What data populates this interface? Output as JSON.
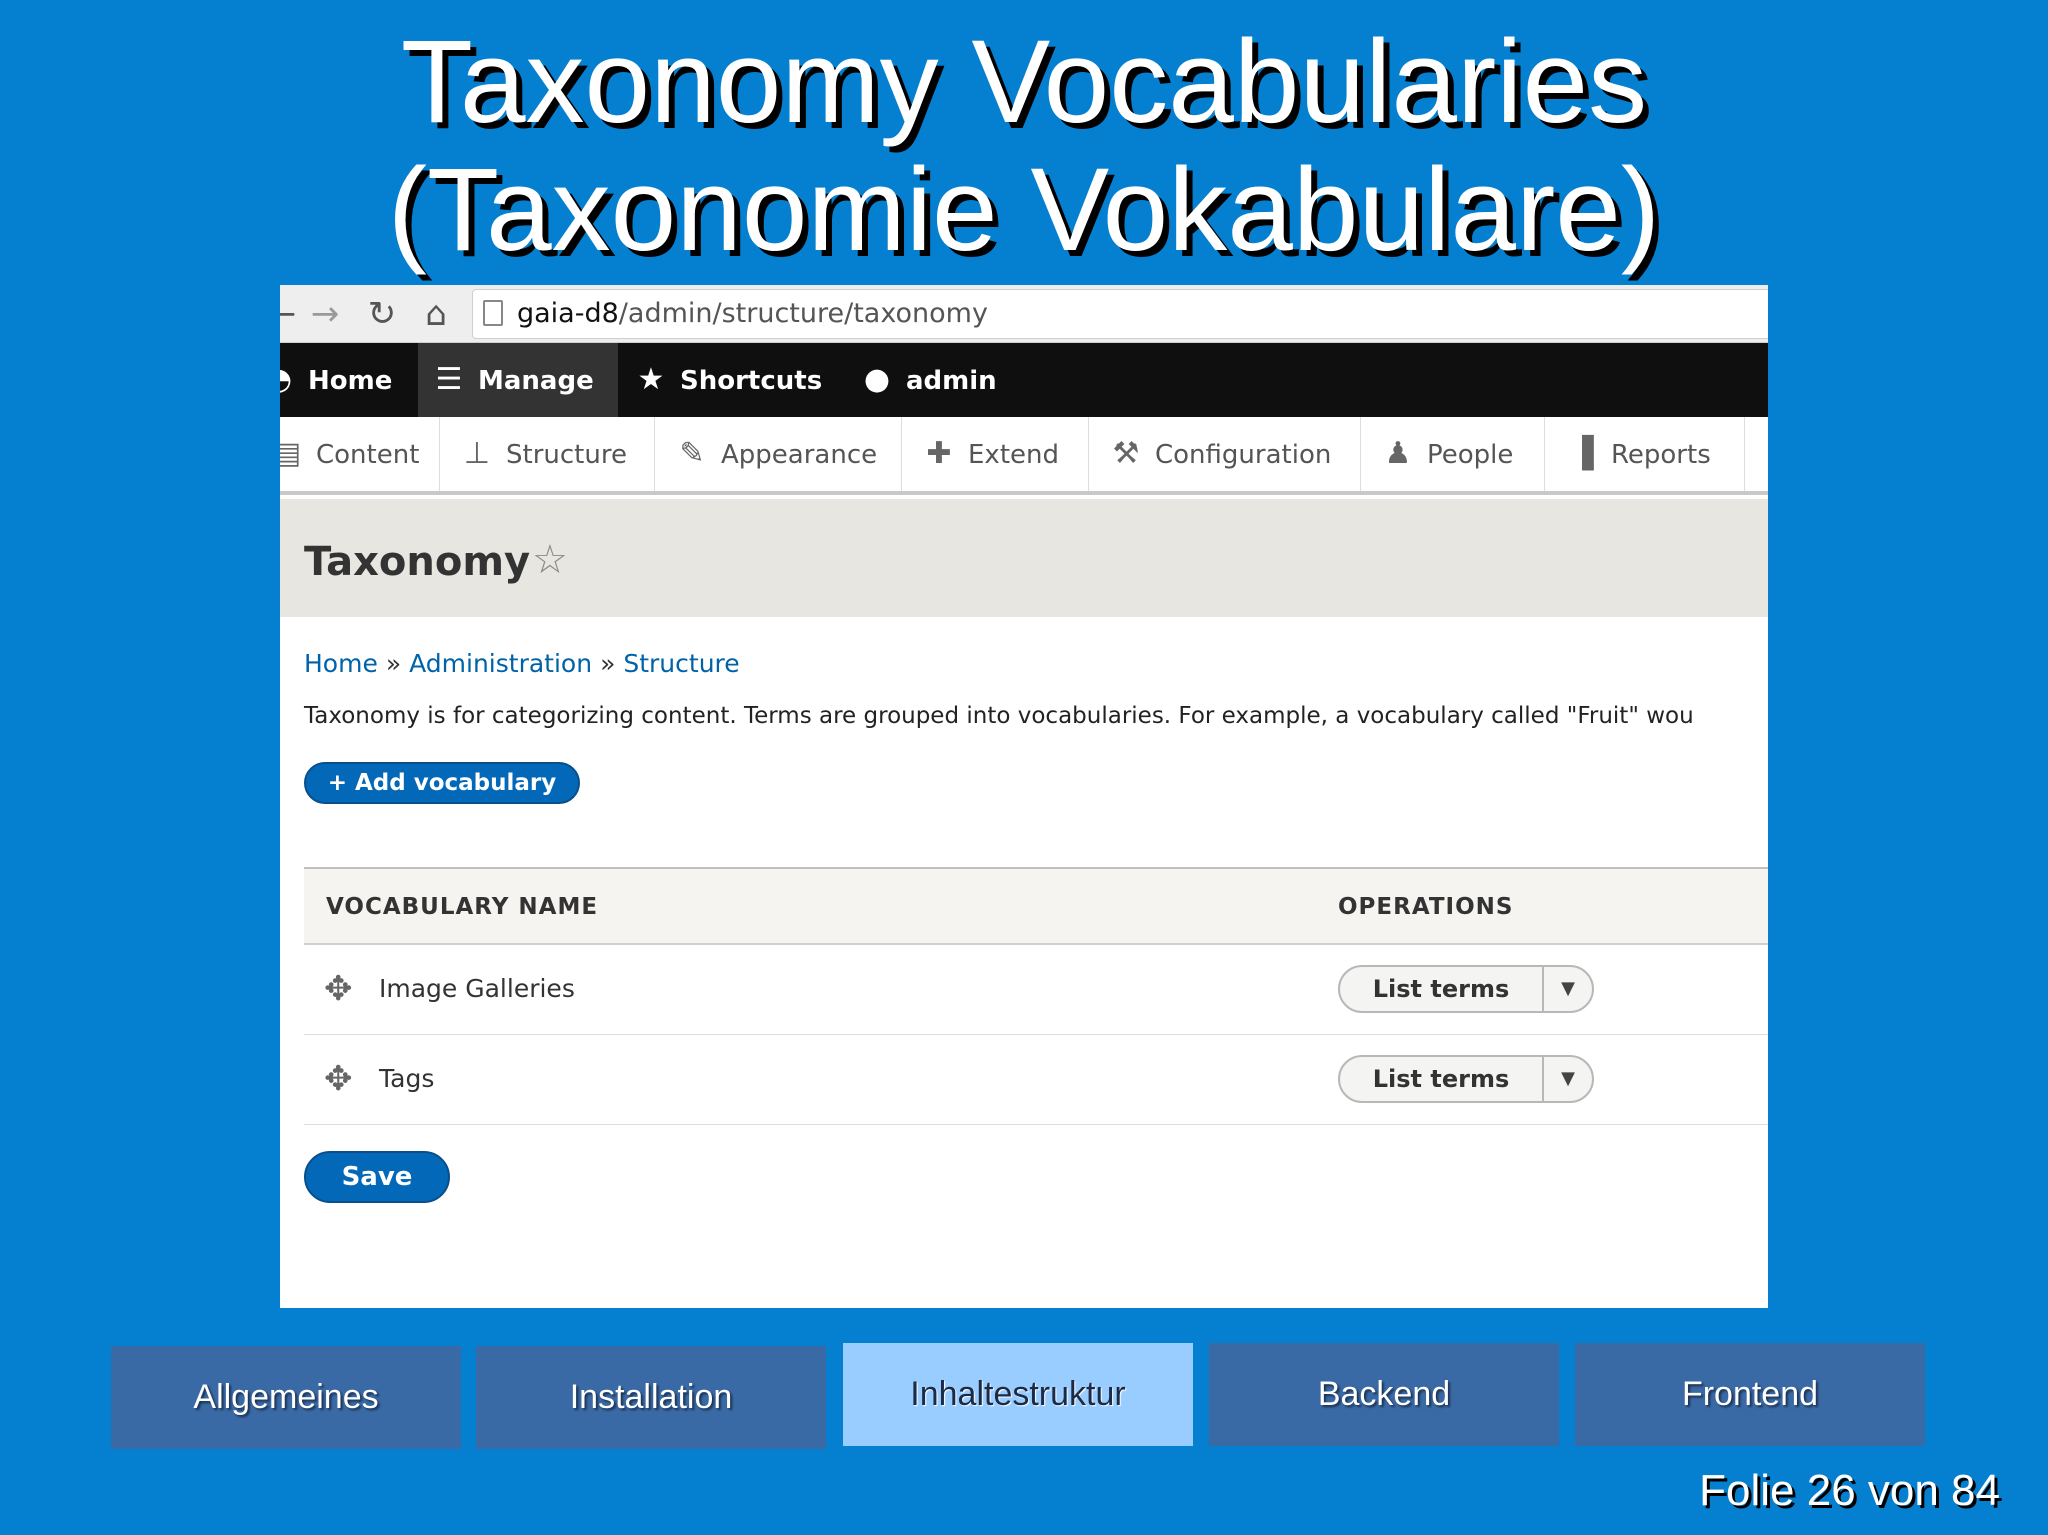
{
  "slide": {
    "title_line1": "Taxonomy Vocabularies",
    "title_line2": "(Taxonomie Vokabulare)",
    "counter": "Folie 26 von 84",
    "nav_tabs": [
      {
        "label": "Allgemeines",
        "current": false
      },
      {
        "label": "Installation",
        "current": false
      },
      {
        "label": "Inhaltestruktur",
        "current": true
      },
      {
        "label": "Backend",
        "current": false
      },
      {
        "label": "Frontend",
        "current": false
      }
    ]
  },
  "browser": {
    "url_host": "gaia-d8",
    "url_path": "/admin/structure/taxonomy"
  },
  "toolbar": {
    "home": "Home",
    "manage": "Manage",
    "shortcuts": "Shortcuts",
    "user": "admin"
  },
  "tray": {
    "content": "Content",
    "structure": "Structure",
    "appearance": "Appearance",
    "extend": "Extend",
    "configuration": "Configuration",
    "people": "People",
    "reports": "Reports"
  },
  "page": {
    "title": "Taxonomy",
    "breadcrumb": [
      "Home",
      "Administration",
      "Structure"
    ],
    "breadcrumb_separator": "»",
    "description": "Taxonomy is for categorizing content. Terms are grouped into vocabularies. For example, a vocabulary called \"Fruit\" wou",
    "add_button": "+ Add vocabulary",
    "table": {
      "headers": [
        "VOCABULARY NAME",
        "OPERATIONS"
      ],
      "rows": [
        {
          "name": "Image Galleries",
          "operation": "List terms"
        },
        {
          "name": "Tags",
          "operation": "List terms"
        }
      ]
    },
    "save_button": "Save"
  },
  "colors": {
    "slide_background": "#0580d0",
    "drupal_blue": "#0368b8",
    "nav_tab": "#3a6aa5",
    "nav_tab_current": "#99ccff"
  }
}
